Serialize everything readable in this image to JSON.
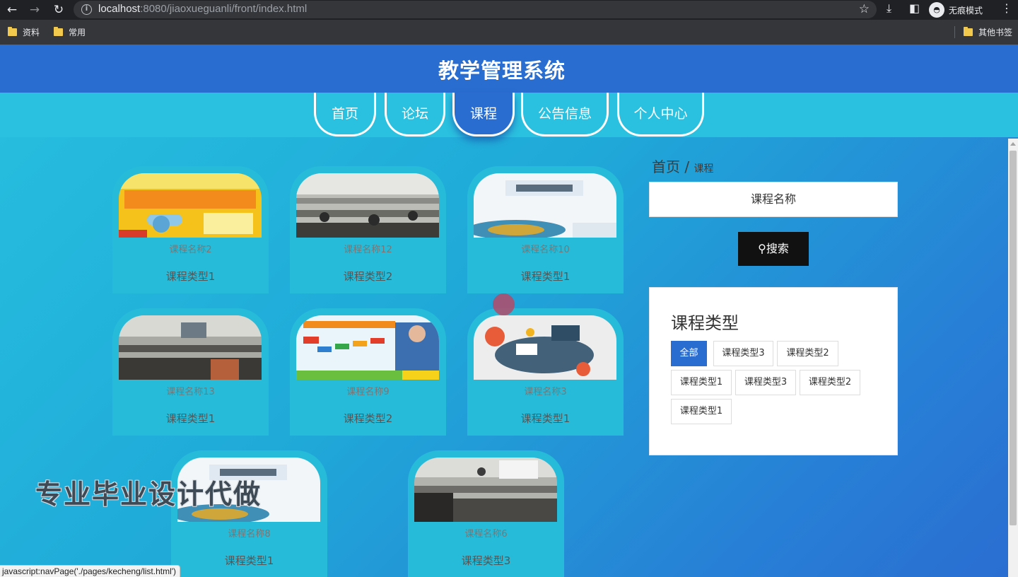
{
  "browser": {
    "url_host": "localhost",
    "url_rest": ":8080/jiaoxueguanli/front/index.html",
    "incognito_label": "无痕模式",
    "bookmarks": [
      "资料",
      "常用"
    ],
    "other_bookmarks": "其他书签"
  },
  "site": {
    "title": "教学管理系统"
  },
  "nav": [
    {
      "label": "首页",
      "active": false
    },
    {
      "label": "论坛",
      "active": false
    },
    {
      "label": "课程",
      "active": true
    },
    {
      "label": "公告信息",
      "active": false
    },
    {
      "label": "个人中心",
      "active": false
    }
  ],
  "courses": [
    {
      "name": "课程名称2",
      "type": "课程类型1"
    },
    {
      "name": "课程名称12",
      "type": "课程类型2"
    },
    {
      "name": "课程名称10",
      "type": "课程类型1"
    },
    {
      "name": "课程名称13",
      "type": "课程类型1"
    },
    {
      "name": "课程名称9",
      "type": "课程类型2"
    },
    {
      "name": "课程名称3",
      "type": "课程类型1"
    },
    {
      "name": "课程名称8",
      "type": "课程类型1"
    },
    {
      "name": "课程名称6",
      "type": "课程类型3"
    }
  ],
  "sidebar": {
    "breadcrumb_home": "首页",
    "breadcrumb_sep": "/",
    "breadcrumb_current": "课程",
    "search_placeholder": "课程名称",
    "search_button": "搜索",
    "type_title": "课程类型",
    "tags": [
      "全部",
      "课程类型3",
      "课程类型2",
      "课程类型1",
      "课程类型3",
      "课程类型2",
      "课程类型1"
    ]
  },
  "watermark": "专业毕业设计代做",
  "status_bar": "javascript:navPage('./pages/kecheng/list.html')"
}
